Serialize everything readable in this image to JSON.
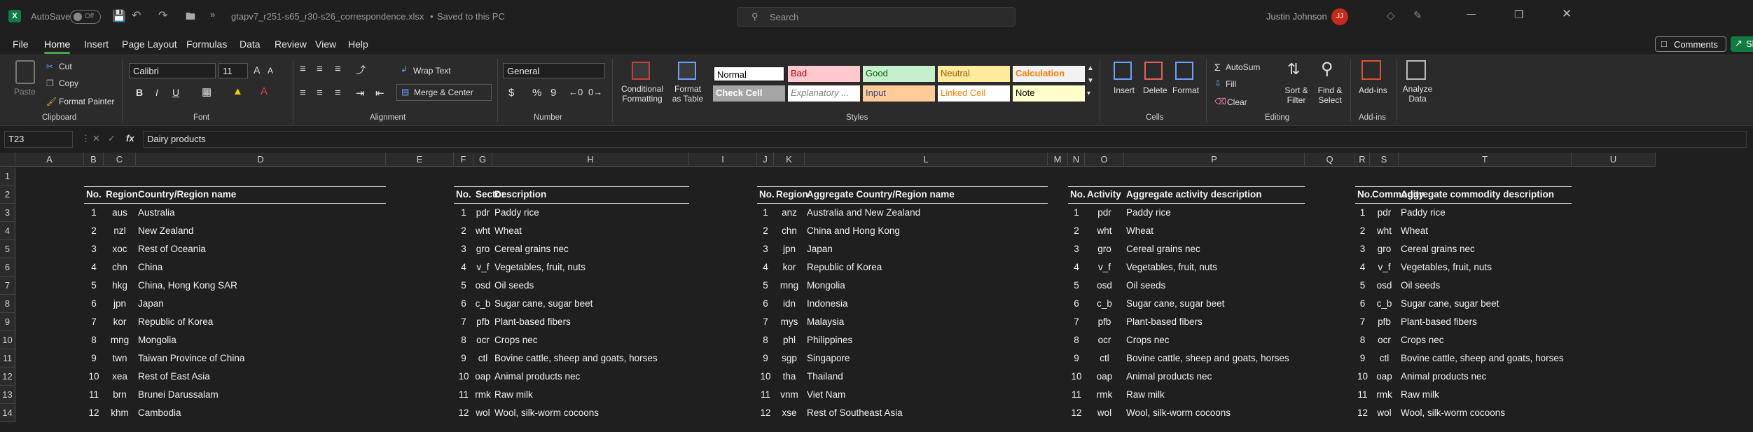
{
  "title_bar": {
    "autosave_label": "AutoSave",
    "autosave_state": "Off",
    "filename": "gtapv7_r251-s65_r30-s26_correspondence.xlsx",
    "saved_status": "Saved to this PC",
    "search_placeholder": "Search",
    "user_name": "Justin Johnson",
    "user_initials": "JJ"
  },
  "menu": {
    "items": [
      "File",
      "Home",
      "Insert",
      "Page Layout",
      "Formulas",
      "Data",
      "Review",
      "View",
      "Help"
    ],
    "active": "Home",
    "comments": "Comments",
    "share": "Sh"
  },
  "ribbon": {
    "clipboard": {
      "paste": "Paste",
      "cut": "Cut",
      "copy": "Copy",
      "format_painter": "Format Painter",
      "group": "Clipboard"
    },
    "font": {
      "name": "Calibri",
      "size": "11",
      "bold": "B",
      "italic": "I",
      "underline": "U",
      "grow": "A",
      "shrink": "A",
      "group": "Font"
    },
    "alignment": {
      "wrap": "Wrap Text",
      "merge": "Merge & Center",
      "group": "Alignment"
    },
    "number": {
      "format": "General",
      "currency": "$",
      "percent": "%",
      "comma": "9",
      "group": "Number"
    },
    "styles": {
      "conditional": "Conditional Formatting",
      "format_table": "Format as Table",
      "cells": [
        "Normal",
        "Bad",
        "Good",
        "Neutral",
        "Calculation",
        "Check Cell",
        "Explanatory ...",
        "Input",
        "Linked Cell",
        "Note"
      ],
      "group": "Styles"
    },
    "cells": {
      "insert": "Insert",
      "delete": "Delete",
      "format": "Format",
      "group": "Cells"
    },
    "editing": {
      "autosum": "AutoSum",
      "fill": "Fill",
      "clear": "Clear",
      "sort": "Sort & Filter",
      "find": "Find & Select",
      "group": "Editing"
    },
    "addins": {
      "addins": "Add-ins",
      "analyze": "Analyze Data",
      "group": "Add-ins"
    }
  },
  "formula_bar": {
    "name_box": "T23",
    "fx": "fx",
    "value": "Dairy products"
  },
  "columns": [
    "A",
    "B",
    "C",
    "D",
    "E",
    "F",
    "G",
    "H",
    "I",
    "J",
    "K",
    "L",
    "M",
    "N",
    "O",
    "P",
    "Q",
    "R",
    "S",
    "T",
    "U"
  ],
  "rows": [
    "1",
    "2",
    "3",
    "4",
    "5",
    "6",
    "7",
    "8",
    "9",
    "10",
    "11",
    "12",
    "13",
    "14"
  ],
  "tables": {
    "t1": {
      "headers": [
        "No.",
        "Region",
        "Country/Region name"
      ],
      "rows": [
        [
          "1",
          "aus",
          "Australia"
        ],
        [
          "2",
          "nzl",
          "New Zealand"
        ],
        [
          "3",
          "xoc",
          "Rest of Oceania"
        ],
        [
          "4",
          "chn",
          "China"
        ],
        [
          "5",
          "hkg",
          "China, Hong Kong SAR"
        ],
        [
          "6",
          "jpn",
          "Japan"
        ],
        [
          "7",
          "kor",
          "Republic of Korea"
        ],
        [
          "8",
          "mng",
          "Mongolia"
        ],
        [
          "9",
          "twn",
          "Taiwan Province of China"
        ],
        [
          "10",
          "xea",
          "Rest of East Asia"
        ],
        [
          "11",
          "brn",
          "Brunei Darussalam"
        ],
        [
          "12",
          "khm",
          "Cambodia"
        ]
      ]
    },
    "t2": {
      "headers": [
        "No.",
        "Sector",
        "Description"
      ],
      "rows": [
        [
          "1",
          "pdr",
          "Paddy rice"
        ],
        [
          "2",
          "wht",
          "Wheat"
        ],
        [
          "3",
          "gro",
          "Cereal grains nec"
        ],
        [
          "4",
          "v_f",
          "Vegetables, fruit, nuts"
        ],
        [
          "5",
          "osd",
          "Oil seeds"
        ],
        [
          "6",
          "c_b",
          "Sugar cane, sugar beet"
        ],
        [
          "7",
          "pfb",
          "Plant-based fibers"
        ],
        [
          "8",
          "ocr",
          "Crops nec"
        ],
        [
          "9",
          "ctl",
          "Bovine cattle, sheep and goats, horses"
        ],
        [
          "10",
          "oap",
          "Animal products nec"
        ],
        [
          "11",
          "rmk",
          "Raw milk"
        ],
        [
          "12",
          "wol",
          "Wool, silk-worm cocoons"
        ]
      ]
    },
    "t3": {
      "headers": [
        "No.",
        "Region",
        "Aggregate Country/Region name"
      ],
      "rows": [
        [
          "1",
          "anz",
          "Australia and New Zealand"
        ],
        [
          "2",
          "chn",
          "China and Hong Kong"
        ],
        [
          "3",
          "jpn",
          "Japan"
        ],
        [
          "4",
          "kor",
          "Republic of Korea"
        ],
        [
          "5",
          "mng",
          "Mongolia"
        ],
        [
          "6",
          "idn",
          "Indonesia"
        ],
        [
          "7",
          "mys",
          "Malaysia"
        ],
        [
          "8",
          "phl",
          "Philippines"
        ],
        [
          "9",
          "sgp",
          "Singapore"
        ],
        [
          "10",
          "tha",
          "Thailand"
        ],
        [
          "11",
          "vnm",
          "Viet Nam"
        ],
        [
          "12",
          "xse",
          "Rest of Southeast Asia"
        ]
      ]
    },
    "t4": {
      "headers": [
        "No.",
        "Activity",
        "Aggregate activity description"
      ],
      "rows": [
        [
          "1",
          "pdr",
          "Paddy rice"
        ],
        [
          "2",
          "wht",
          "Wheat"
        ],
        [
          "3",
          "gro",
          "Cereal grains nec"
        ],
        [
          "4",
          "v_f",
          "Vegetables, fruit, nuts"
        ],
        [
          "5",
          "osd",
          "Oil seeds"
        ],
        [
          "6",
          "c_b",
          "Sugar cane, sugar beet"
        ],
        [
          "7",
          "pfb",
          "Plant-based fibers"
        ],
        [
          "8",
          "ocr",
          "Crops nec"
        ],
        [
          "9",
          "ctl",
          "Bovine cattle, sheep and goats, horses"
        ],
        [
          "10",
          "oap",
          "Animal products nec"
        ],
        [
          "11",
          "rmk",
          "Raw milk"
        ],
        [
          "12",
          "wol",
          "Wool, silk-worm cocoons"
        ]
      ]
    },
    "t5": {
      "headers": [
        "No.",
        "Commodity",
        "Aggregate commodity description"
      ],
      "rows": [
        [
          "1",
          "pdr",
          "Paddy rice"
        ],
        [
          "2",
          "wht",
          "Wheat"
        ],
        [
          "3",
          "gro",
          "Cereal grains nec"
        ],
        [
          "4",
          "v_f",
          "Vegetables, fruit, nuts"
        ],
        [
          "5",
          "osd",
          "Oil seeds"
        ],
        [
          "6",
          "c_b",
          "Sugar cane, sugar beet"
        ],
        [
          "7",
          "pfb",
          "Plant-based fibers"
        ],
        [
          "8",
          "ocr",
          "Crops nec"
        ],
        [
          "9",
          "ctl",
          "Bovine cattle, sheep and goats, horses"
        ],
        [
          "10",
          "oap",
          "Animal products nec"
        ],
        [
          "11",
          "rmk",
          "Raw milk"
        ],
        [
          "12",
          "wol",
          "Wool, silk-worm cocoons"
        ]
      ]
    }
  },
  "colors": {
    "accent": "#4aa64a",
    "excel_green": "#107c41",
    "avatar": "#c42b1c"
  }
}
